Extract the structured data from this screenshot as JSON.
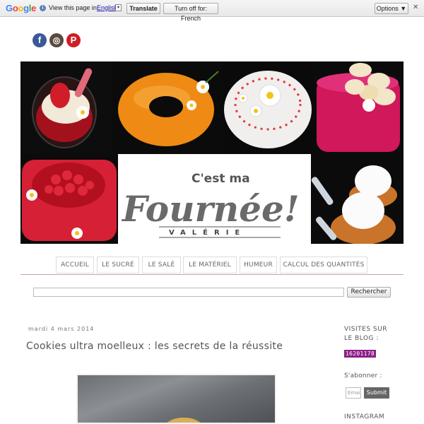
{
  "translate_bar": {
    "logo": [
      "G",
      "o",
      "o",
      "g",
      "l",
      "e"
    ],
    "view_text": "View this page in:",
    "language": "English",
    "language_arrow": "▾",
    "translate_label": "Translate",
    "turn_off_label": "Turn off for: French",
    "options_label": "Options ▼",
    "close_label": "✕"
  },
  "social": {
    "facebook": "f",
    "instagram": "◎",
    "pinterest": "P",
    "colors": {
      "facebook": "#3b5998",
      "instagram": "#5a4a3e",
      "pinterest": "#cb2027"
    }
  },
  "header": {
    "logo_top": "C'est ma",
    "logo_main": "Fournée!",
    "logo_sub": "VALÉRIE"
  },
  "nav": {
    "items": [
      "ACCUEIL",
      "LE SUCRÉ",
      "LE SALÉ",
      "LE MATÉRIEL",
      "HUMEUR",
      "CALCUL DES QUANTITÉS"
    ]
  },
  "search": {
    "button": "Rechercher"
  },
  "post": {
    "date": "mardi 4 mars 2014",
    "title": "Cookies ultra moelleux : les secrets de la réussite"
  },
  "sidebar": {
    "visits_title_1": "VISITES SUR",
    "visits_title_2": "LE BLOG :",
    "visits_count": "16201178",
    "subscribe_title": "S'abonner :",
    "email_placeholder": "Email",
    "submit_label": "Submit",
    "instagram_title": "INSTAGRAM"
  }
}
